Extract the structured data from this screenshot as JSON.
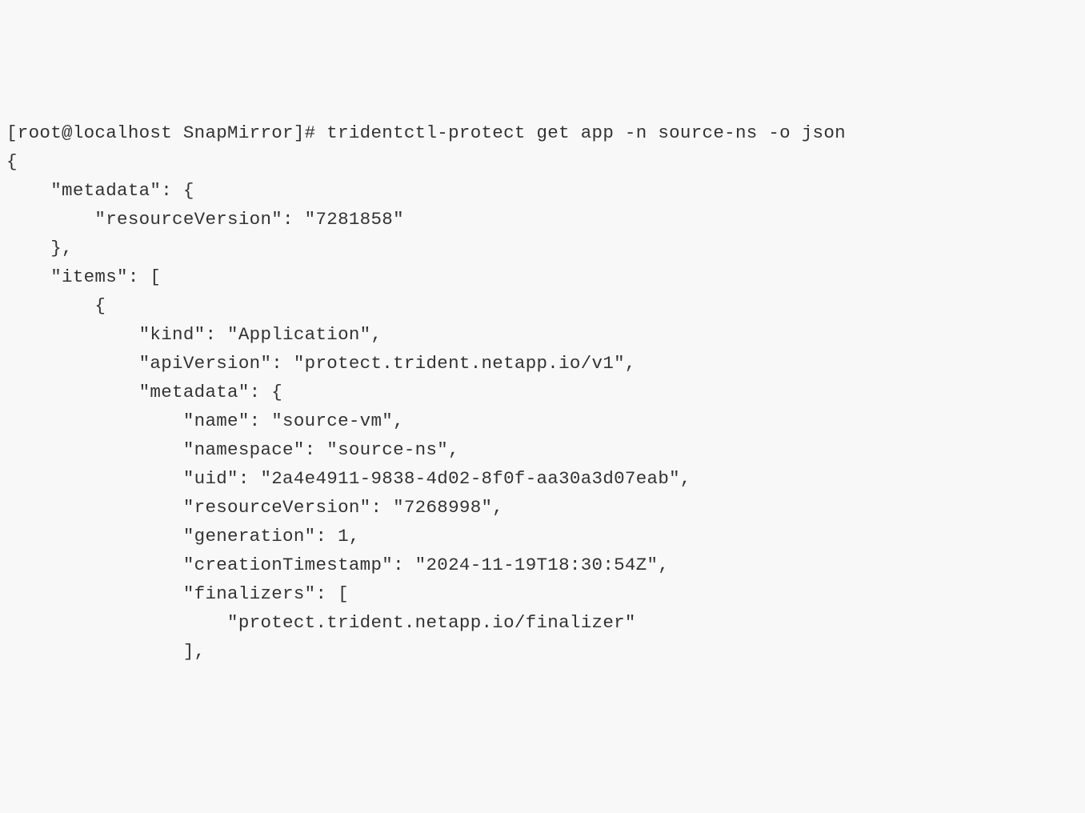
{
  "prompt_prefix": "[root@localhost SnapMirror]# ",
  "command": "tridentctl-protect get app -n source-ns -o json",
  "json_output": {
    "line_open_brace": "{",
    "metadata_key": "    \"metadata\": {",
    "resourceVersion_line": "        \"resourceVersion\": \"7281858\"",
    "metadata_close": "    },",
    "items_key": "    \"items\": [",
    "item_open": "        {",
    "kind_line": "            \"kind\": \"Application\",",
    "apiVersion_line": "            \"apiVersion\": \"protect.trident.netapp.io/v1\",",
    "item_metadata_open": "            \"metadata\": {",
    "name_line": "                \"name\": \"source-vm\",",
    "namespace_line": "                \"namespace\": \"source-ns\",",
    "uid_line": "                \"uid\": \"2a4e4911-9838-4d02-8f0f-aa30a3d07eab\",",
    "item_resourceVersion_line": "                \"resourceVersion\": \"7268998\",",
    "generation_line": "                \"generation\": 1,",
    "creationTimestamp_line": "                \"creationTimestamp\": \"2024-11-19T18:30:54Z\",",
    "finalizers_open": "                \"finalizers\": [",
    "finalizer_value": "                    \"protect.trident.netapp.io/finalizer\"",
    "finalizers_close": "                ],"
  }
}
